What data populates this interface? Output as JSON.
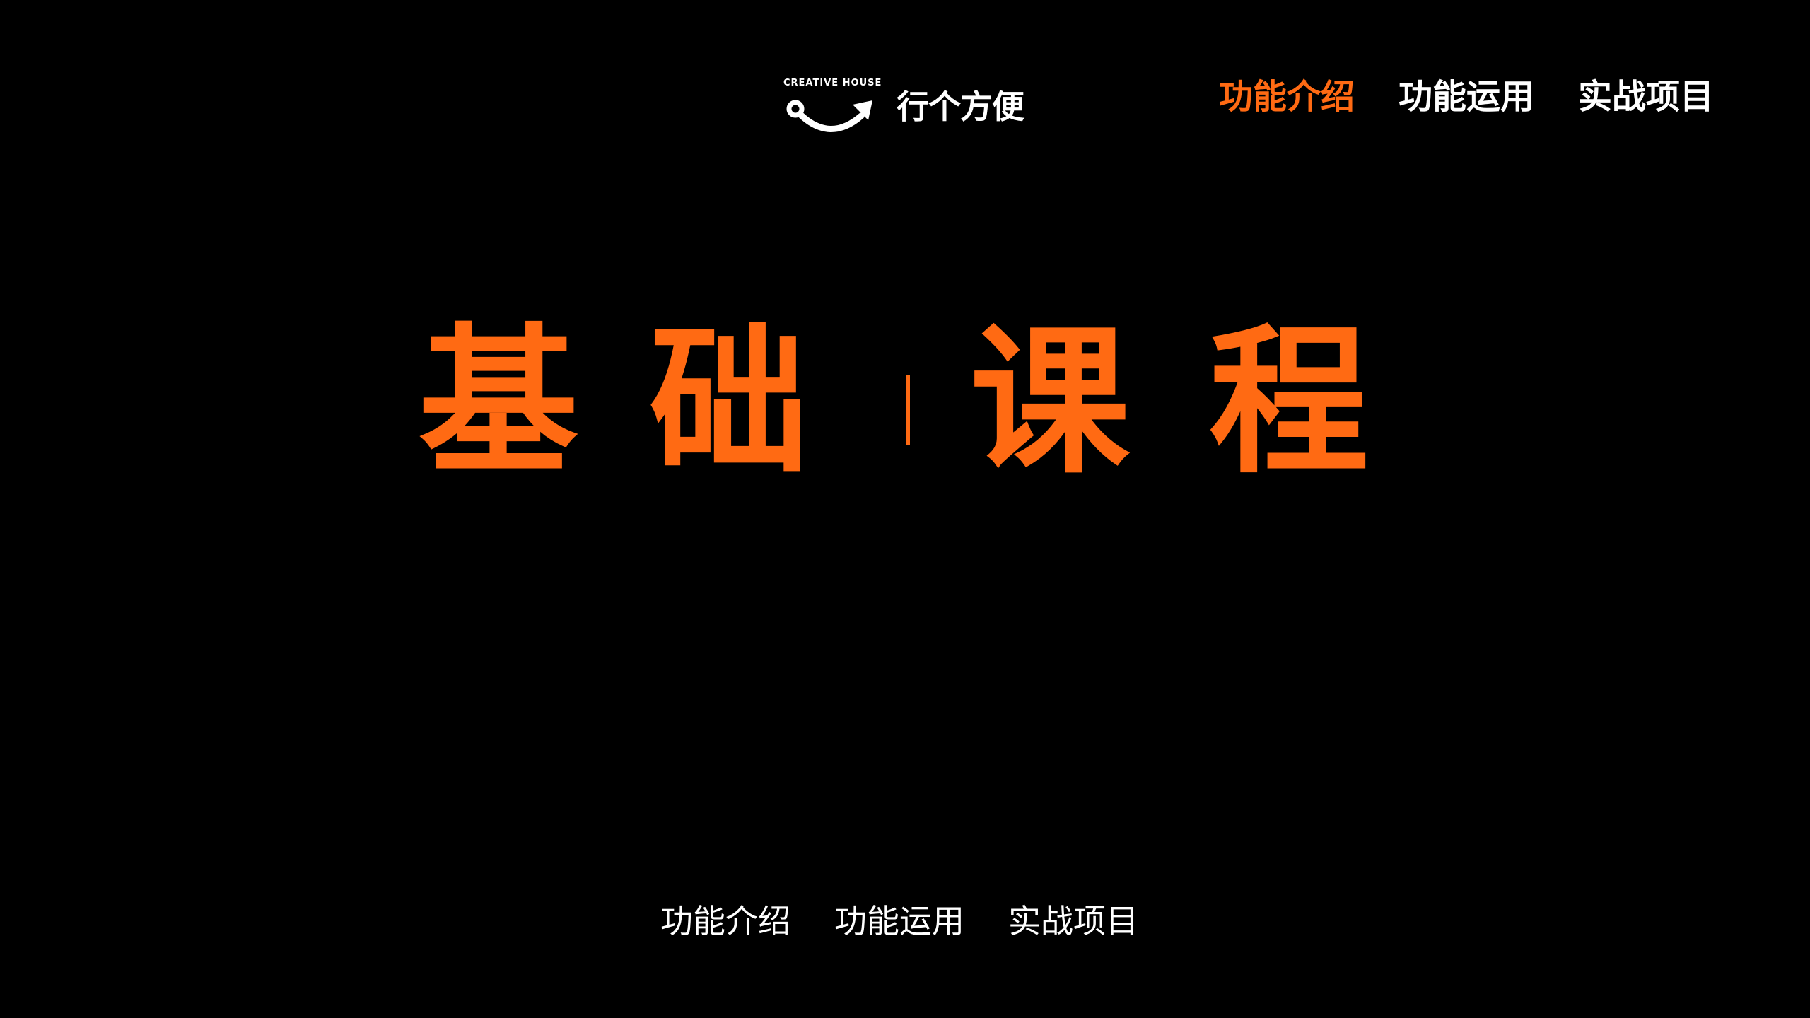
{
  "colors": {
    "background": "#000000",
    "accent": "#ff6a13",
    "text": "#ffffff"
  },
  "logo": {
    "caption": "CREATIVE HOUSE",
    "name": "行个方便",
    "icon": "smile-arrow-icon"
  },
  "top_nav": {
    "items": [
      {
        "label": "功能介绍",
        "active": true
      },
      {
        "label": "功能运用",
        "active": false
      },
      {
        "label": "实战项目",
        "active": false
      }
    ]
  },
  "hero": {
    "chars": [
      "基",
      "础",
      "课",
      "程"
    ]
  },
  "bottom_nav": {
    "items": [
      {
        "label": "功能介绍"
      },
      {
        "label": "功能运用"
      },
      {
        "label": "实战项目"
      }
    ]
  }
}
